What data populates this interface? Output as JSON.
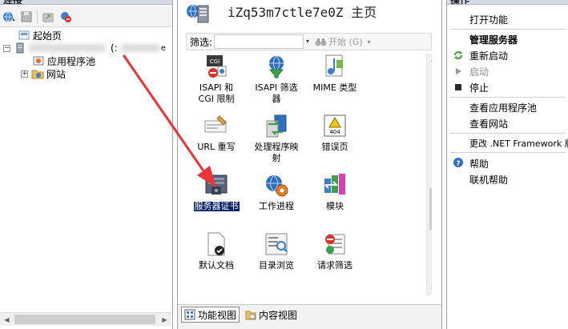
{
  "connections": {
    "header": "连接",
    "tree": {
      "start_page": "起始页",
      "server_suffix": "(:",
      "server_tail": "e",
      "app_pools": "应用程序池",
      "sites": "网站"
    }
  },
  "main": {
    "title": "iZq53m7ctle7e0Z 主页",
    "filter": {
      "label": "筛选:",
      "value": "",
      "go_label": "开始 (G)",
      "dropdown_glyph": "▾"
    },
    "features": [
      {
        "label_line1": "ISAPI 和",
        "label_line2": "CGI 限制",
        "icon": "isapi-cgi-restrictions-icon"
      },
      {
        "label_line1": "ISAPI 筛选",
        "label_line2": "器",
        "icon": "isapi-filters-icon"
      },
      {
        "label_line1": "MIME 类型",
        "label_line2": "",
        "icon": "mime-types-icon"
      },
      {
        "label_line1": "URL 重写",
        "label_line2": "",
        "icon": "url-rewrite-icon"
      },
      {
        "label_line1": "处理程序映",
        "label_line2": "射",
        "icon": "handler-mappings-icon"
      },
      {
        "label_line1": "错误页",
        "label_line2": "",
        "icon": "error-pages-icon"
      },
      {
        "label_line1": "服务器证书",
        "label_line2": "",
        "icon": "server-certificates-icon",
        "selected": true
      },
      {
        "label_line1": "工作进程",
        "label_line2": "",
        "icon": "worker-processes-icon"
      },
      {
        "label_line1": "模块",
        "label_line2": "",
        "icon": "modules-icon"
      },
      {
        "label_line1": "默认文档",
        "label_line2": "",
        "icon": "default-document-icon"
      },
      {
        "label_line1": "目录浏览",
        "label_line2": "",
        "icon": "directory-browsing-icon"
      },
      {
        "label_line1": "请求筛选",
        "label_line2": "",
        "icon": "request-filtering-icon"
      }
    ],
    "error_badge": "404",
    "cgi_badge": "CGI",
    "view_tabs": {
      "features_view": "功能视图",
      "content_view": "内容视图"
    }
  },
  "actions": {
    "header": "操作",
    "open_feature": "打开功能",
    "manage_server": "管理服务器",
    "restart": "重新启动",
    "start": "启动",
    "stop": "停止",
    "view_app_pools": "查看应用程序池",
    "view_sites": "查看网站",
    "change_framework": "更改 .NET Framework 版本",
    "help": "帮助",
    "online_help": "联机帮助"
  },
  "colors": {
    "selection": "#0a246a",
    "annotation_arrow": "#e8343a",
    "help_icon": "#2f6fbf",
    "restart_icon": "#2fa33a"
  }
}
